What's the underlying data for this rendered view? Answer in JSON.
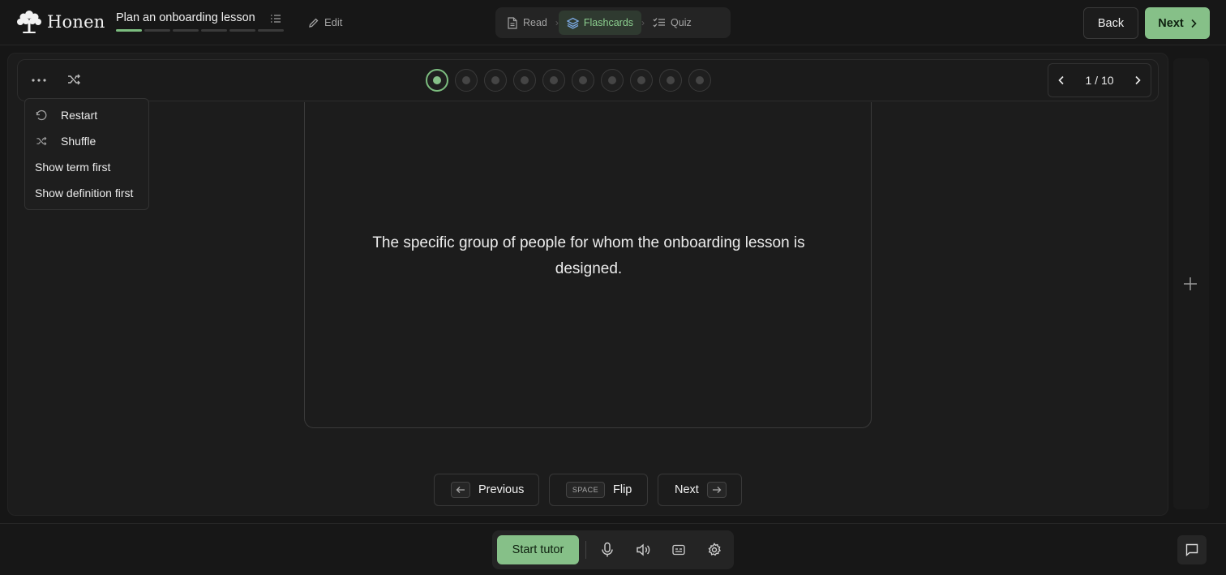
{
  "brand": {
    "name": "Honen"
  },
  "lesson": {
    "title": "Plan an onboarding lesson",
    "segments_total": 6,
    "segments_done": 1
  },
  "header": {
    "edit_label": "Edit",
    "modes": [
      {
        "label": "Read",
        "icon": "document-icon",
        "active": false
      },
      {
        "label": "Flashcards",
        "icon": "layers-icon",
        "active": true
      },
      {
        "label": "Quiz",
        "icon": "checklist-icon",
        "active": false
      }
    ],
    "back_label": "Back",
    "next_label": "Next"
  },
  "flashcards": {
    "current": 1,
    "total": 10,
    "counter": "1 / 10",
    "card_text": "The specific group of people for whom the onboarding lesson is designed."
  },
  "options_menu": {
    "items": [
      {
        "label": "Restart",
        "icon": "restart-icon"
      },
      {
        "label": "Shuffle",
        "icon": "shuffle-icon"
      },
      {
        "label": "Show term first",
        "icon": ""
      },
      {
        "label": "Show definition first",
        "icon": ""
      }
    ]
  },
  "controls": {
    "previous_label": "Previous",
    "flip_key": "SPACE",
    "flip_label": "Flip",
    "next_label": "Next"
  },
  "tutor": {
    "start_label": "Start tutor"
  },
  "colors": {
    "accent": "#86c088",
    "background": "#161616",
    "panel": "#1c1c1c"
  }
}
